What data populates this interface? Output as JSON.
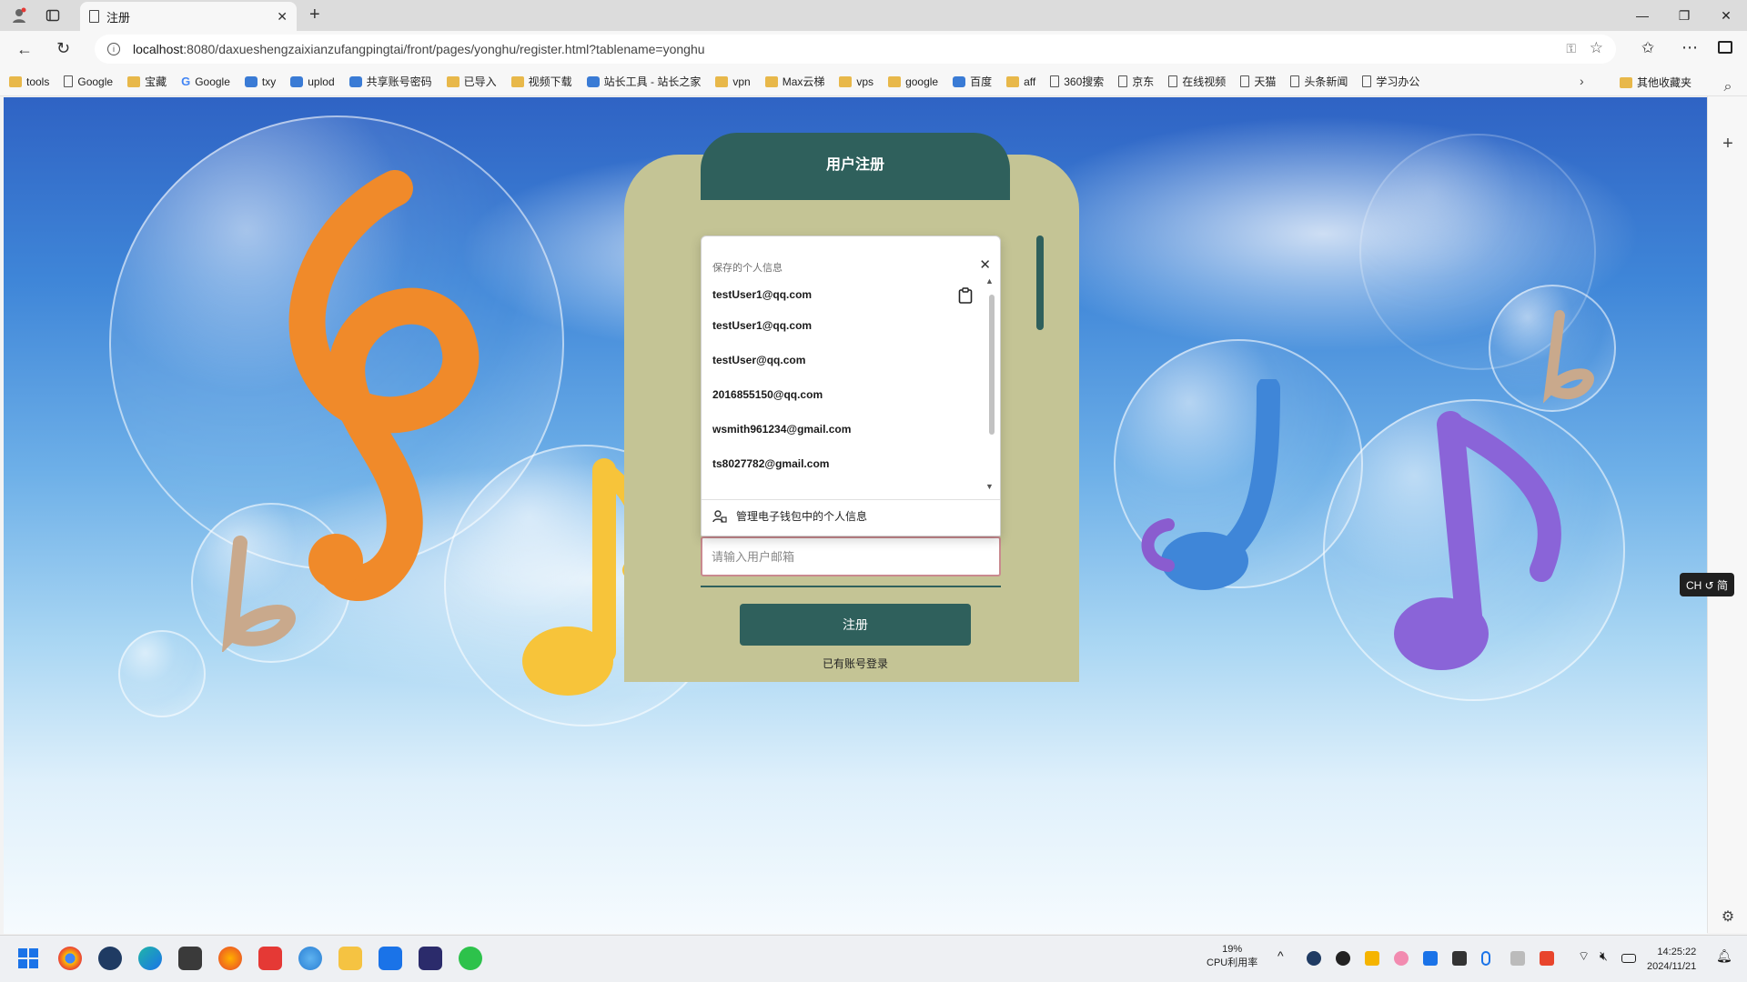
{
  "browser": {
    "tab_title": "注册",
    "url_host": "localhost",
    "url_path": ":8080/daxueshengzaixianzufangpingtai/front/pages/yonghu/register.html?tablename=yonghu"
  },
  "bookmarks": [
    {
      "label": "tools",
      "icon": "folder-icon"
    },
    {
      "label": "Google",
      "icon": "page-icon"
    },
    {
      "label": "宝藏",
      "icon": "folder-icon"
    },
    {
      "label": "Google",
      "icon": "google-icon"
    },
    {
      "label": "txy",
      "icon": "cloud-icon"
    },
    {
      "label": "uplod",
      "icon": "cloud-icon"
    },
    {
      "label": "共享账号密码",
      "icon": "app-icon"
    },
    {
      "label": "已导入",
      "icon": "folder-icon"
    },
    {
      "label": "视频下载",
      "icon": "folder-icon"
    },
    {
      "label": "站长工具 - 站长之家",
      "icon": "app-icon"
    },
    {
      "label": "vpn",
      "icon": "folder-icon"
    },
    {
      "label": "Max云梯",
      "icon": "folder-icon"
    },
    {
      "label": "vps",
      "icon": "folder-icon"
    },
    {
      "label": "google",
      "icon": "folder-icon"
    },
    {
      "label": "百度",
      "icon": "baidu-icon"
    },
    {
      "label": "aff",
      "icon": "folder-icon"
    },
    {
      "label": "360搜索",
      "icon": "page-icon"
    },
    {
      "label": "京东",
      "icon": "page-icon"
    },
    {
      "label": "在线视频",
      "icon": "page-icon"
    },
    {
      "label": "天猫",
      "icon": "page-icon"
    },
    {
      "label": "头条新闻",
      "icon": "page-icon"
    },
    {
      "label": "学习办公",
      "icon": "page-icon"
    }
  ],
  "other_bookmarks": "其他收藏夹",
  "register": {
    "title": "用户注册",
    "email_placeholder": "请输入用户邮箱",
    "submit_label": "注册",
    "login_link": "已有账号登录"
  },
  "autofill": {
    "title": "保存的个人信息",
    "items": [
      "testUser1@qq.com",
      "testUser1@qq.com",
      "testUser@qq.com",
      "2016855150@qq.com",
      "wsmith961234@gmail.com",
      "ts8027782@gmail.com"
    ],
    "manage_label": "管理电子钱包中的个人信息"
  },
  "ime": "CH ↺ 简",
  "taskbar": {
    "cpu_percent": "19%",
    "cpu_label": "CPU利用率",
    "time": "14:25:22",
    "date": "2024/11/21"
  },
  "colors": {
    "card": "#c4c495",
    "header": "#2f605c",
    "input_border": "#c98a8f"
  }
}
